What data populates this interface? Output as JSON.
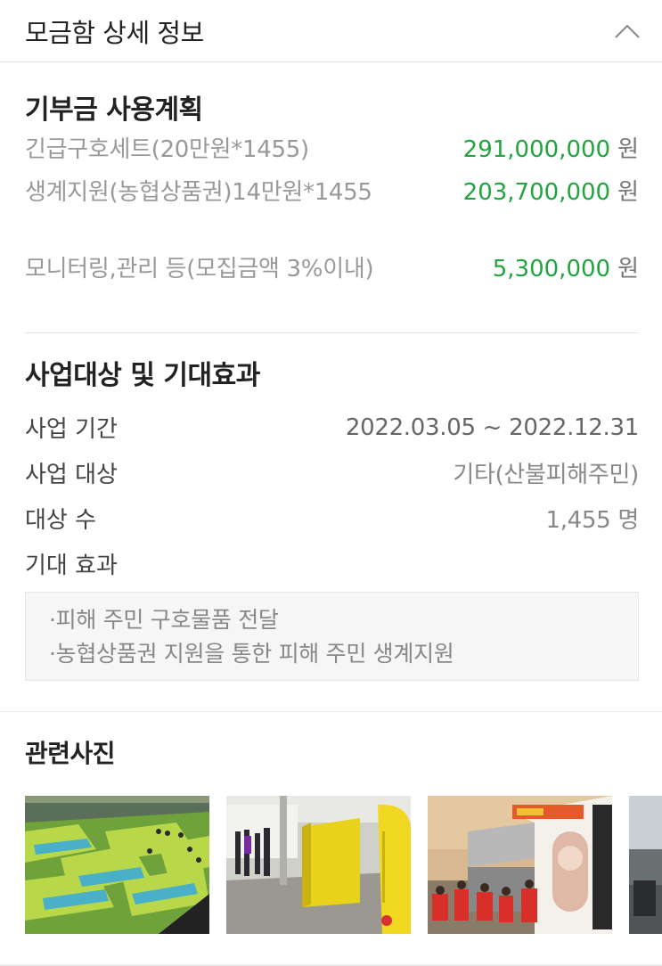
{
  "header": {
    "title": "모금함 상세 정보"
  },
  "plan": {
    "title": "기부금 사용계획",
    "unit": "원",
    "items": [
      {
        "label": "긴급구호세트(20만원*1455)",
        "amount": "291,000,000"
      },
      {
        "label": "생계지원(농협상품권)14만원*1455",
        "amount": "203,700,000"
      },
      {
        "label": "모니터링,관리 등(모집금액 3%이내)",
        "amount": "5,300,000"
      }
    ]
  },
  "project": {
    "title": "사업대상 및 기대효과",
    "period_label": "사업 기간",
    "period_value": "2022.03.05 ~ 2022.12.31",
    "target_label": "사업 대상",
    "target_value": "기타(산불피해주민)",
    "count_label": "대상 수",
    "count_value": "1,455 명",
    "effect_label": "기대 효과",
    "effects": [
      "·피해 주민 구호물품 전달",
      "·농협상품권 지원을 통한 피해 주민 생계지원"
    ]
  },
  "photos": {
    "title": "관련사진",
    "items": [
      {
        "name": "shelter-tents-photo"
      },
      {
        "name": "hallway-tents-photo"
      },
      {
        "name": "relief-truck-photo"
      },
      {
        "name": "street-photo"
      }
    ]
  },
  "colors": {
    "amount": "#23a342",
    "muted": "#999999"
  }
}
